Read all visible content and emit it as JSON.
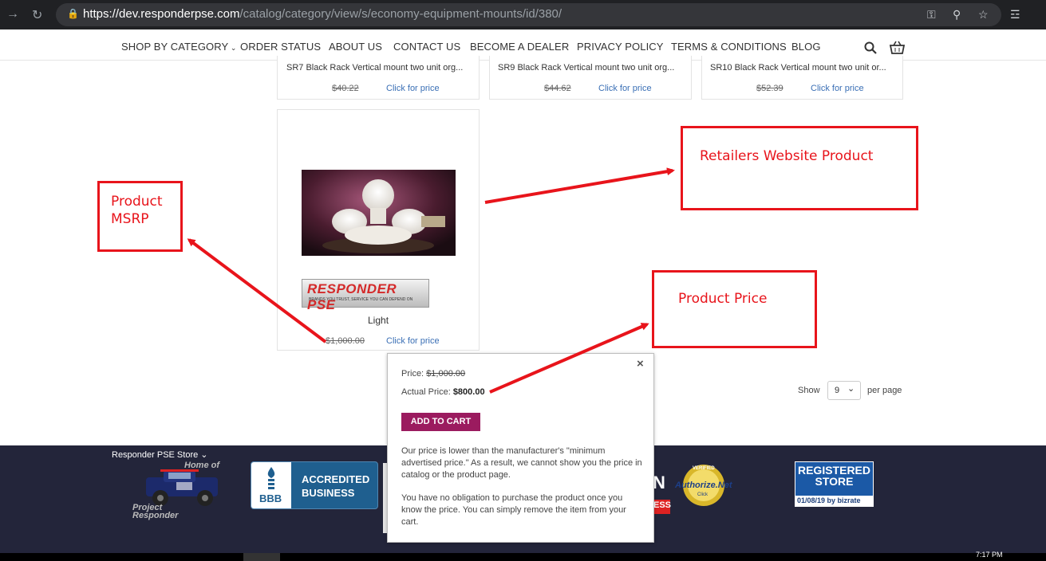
{
  "browser": {
    "url_scheme": "https://",
    "url_host": "dev.responderpse.com",
    "url_path": "/catalog/category/view/s/economy-equipment-mounts/id/380/"
  },
  "nav": {
    "items": [
      "SHOP BY CATEGORY",
      "ORDER STATUS",
      "ABOUT US",
      "CONTACT US",
      "BECOME A DEALER",
      "PRIVACY POLICY",
      "TERMS & CONDITIONS",
      "BLOG"
    ]
  },
  "products_top": [
    {
      "name": "SR7 Black Rack Vertical mount two unit org...",
      "old_price": "$40.22",
      "price_link": "Click for price"
    },
    {
      "name": "SR9 Black Rack Vertical mount two unit org...",
      "old_price": "$44.62",
      "price_link": "Click for price"
    },
    {
      "name": "SR10 Black Rack Vertical mount two unit or...",
      "old_price": "$52.39",
      "price_link": "Click for price"
    }
  ],
  "product_main": {
    "name": "Light",
    "old_price": "$1,000.00",
    "price_link": "Click for price",
    "logo_text": "RESPONDER PSE",
    "logo_tagline": "BRANDS YOU TRUST, SERVICE YOU CAN DEPEND ON"
  },
  "annotations": {
    "retailer": "Retailers Website Product",
    "msrp": "Product\nMSRP",
    "price": "Product Price",
    "color": "#e8141b"
  },
  "popup": {
    "price_label": "Price:",
    "price_value": "$1,000.00",
    "actual_label": "Actual Price:",
    "actual_value": "$800.00",
    "add_to_cart": "ADD TO CART",
    "para1": "Our price is lower than the manufacturer's \"minimum advertised price.\" As a result, we cannot show you the price in catalog or the product page.",
    "para2": "You have no obligation to purchase the product once you know the price. You can simply remove the item from your cart.",
    "close": "×"
  },
  "pager": {
    "show_label": "Show",
    "per_page_value": "9",
    "per_page_label": "per page"
  },
  "footer": {
    "store_label": "Responder PSE Store",
    "home_of": "Home of",
    "project_responder": "Project\nResponder",
    "bbb_accredited": "ACCREDITED",
    "bbb_business": "BUSINESS",
    "bbb": "BBB",
    "authorize_net": "Authorize.Net",
    "authorize_click": "Click",
    "authorize_verified": "VERIFIED",
    "registered_store": "REGISTERED\nSTORE",
    "bizrate": "01/08/19 by bizrate",
    "partial_ess": "ESS",
    "partial_n": "N"
  },
  "taskbar": {
    "time": "7:17 PM"
  }
}
